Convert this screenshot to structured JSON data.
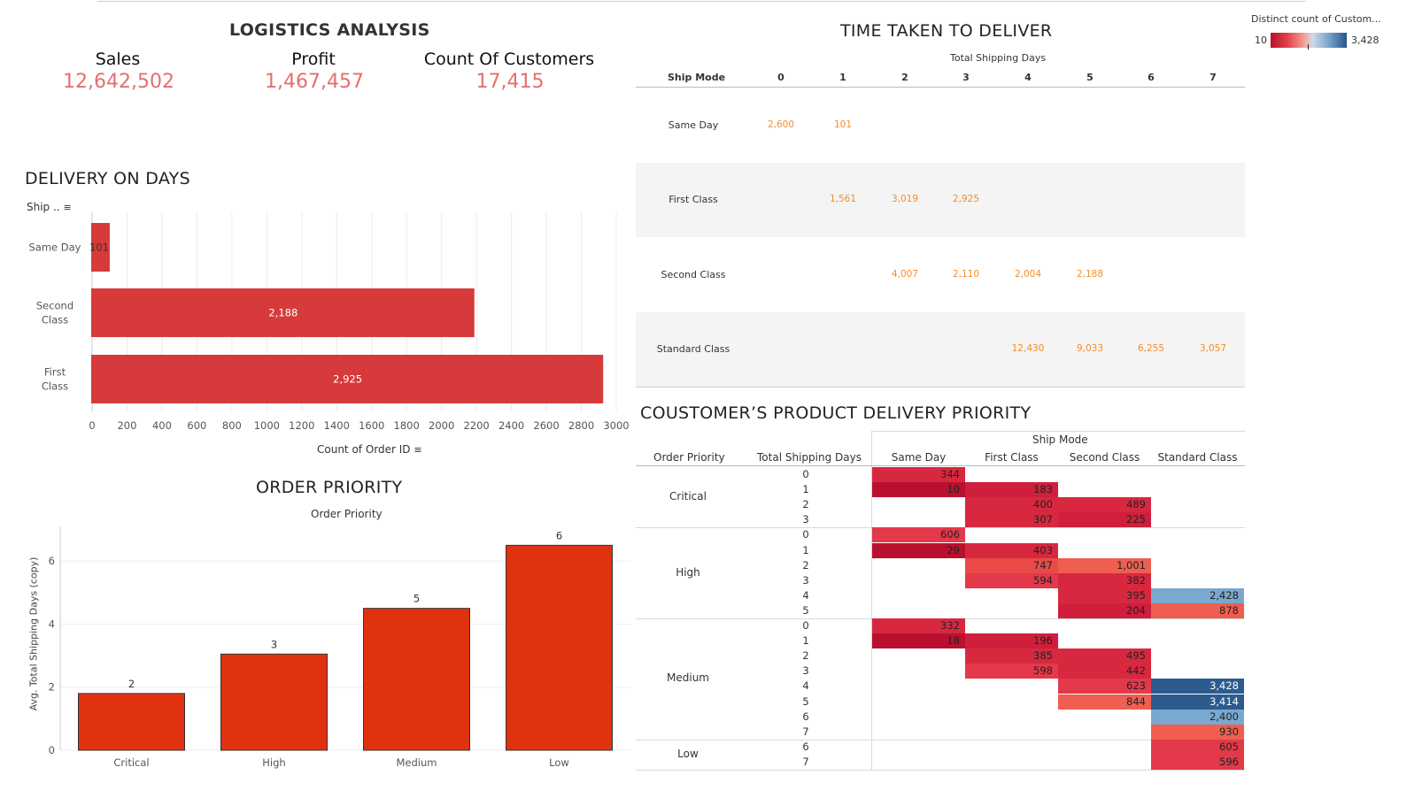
{
  "dashboard": {
    "main_title": "LOGISTICS ANALYSIS",
    "kpis": [
      {
        "label": "Sales",
        "value": "12,642,502"
      },
      {
        "label": "Profit",
        "value": "1,467,457"
      },
      {
        "label": "Count Of Customers",
        "value": "17,415"
      }
    ],
    "legend": {
      "title": "Distinct count of Custom...",
      "min": "10",
      "max": "3,428"
    }
  },
  "delivery_on_days": {
    "title": "DELIVERY ON DAYS",
    "axis_header": "Ship ..",
    "xlabel": "Count of Order ID",
    "chart_data": {
      "type": "bar",
      "orientation": "horizontal",
      "categories": [
        "Same Day",
        "Second Class",
        "First Class"
      ],
      "values": [
        101,
        2188,
        2925
      ],
      "value_labels": [
        "101",
        "2,188",
        "2,925"
      ],
      "xticks": [
        0,
        200,
        400,
        600,
        800,
        1000,
        1200,
        1400,
        1600,
        1800,
        2000,
        2200,
        2400,
        2600,
        2800,
        3000
      ],
      "xlim": [
        0,
        3000
      ],
      "color": "#d63a3a"
    }
  },
  "order_priority": {
    "title": "ORDER PRIORITY",
    "subtitle": "Order Priority",
    "ylabel": "Avg. Total Shipping Days (copy)",
    "chart_data": {
      "type": "bar",
      "categories": [
        "Critical",
        "High",
        "Medium",
        "Low"
      ],
      "values": [
        1.8,
        3.05,
        4.5,
        6.5
      ],
      "value_labels": [
        "2",
        "3",
        "5",
        "6"
      ],
      "yticks": [
        0,
        2,
        4,
        6
      ],
      "ylim": [
        0,
        7.1
      ],
      "color": "#e0320f"
    }
  },
  "time_taken": {
    "title": "TIME TAKEN TO DELIVER",
    "col_header": "Total Shipping Days",
    "row_header": "Ship Mode",
    "columns": [
      "0",
      "1",
      "2",
      "3",
      "4",
      "5",
      "6",
      "7"
    ],
    "rows": [
      {
        "label": "Same Day",
        "cells": [
          "2,600",
          "101",
          "",
          "",
          "",
          "",
          "",
          ""
        ]
      },
      {
        "label": "First Class",
        "cells": [
          "",
          "1,561",
          "3,019",
          "2,925",
          "",
          "",
          "",
          ""
        ]
      },
      {
        "label": "Second Class",
        "cells": [
          "",
          "",
          "4,007",
          "2,110",
          "2,004",
          "2,188",
          "",
          ""
        ]
      },
      {
        "label": "Standard Class",
        "cells": [
          "",
          "",
          "",
          "",
          "12,430",
          "9,033",
          "6,255",
          "3,057"
        ]
      }
    ]
  },
  "priority_heatmap": {
    "title": "COUSTOMER’S PRODUCT DELIVERY PRIORITY",
    "ship_mode_header": "Ship Mode",
    "order_priority_header": "Order Priority",
    "days_header": "Total Shipping Days",
    "columns": [
      "Same Day",
      "First Class",
      "Second Class",
      "Standard Class"
    ],
    "groups": [
      {
        "label": "Critical",
        "rows": [
          {
            "day": "0",
            "cells": [
              "344",
              "",
              "",
              ""
            ]
          },
          {
            "day": "1",
            "cells": [
              "10",
              "183",
              "",
              ""
            ]
          },
          {
            "day": "2",
            "cells": [
              "",
              "400",
              "489",
              ""
            ]
          },
          {
            "day": "3",
            "cells": [
              "",
              "307",
              "225",
              ""
            ]
          }
        ]
      },
      {
        "label": "High",
        "rows": [
          {
            "day": "0",
            "cells": [
              "606",
              "",
              "",
              ""
            ]
          },
          {
            "day": "1",
            "cells": [
              "29",
              "403",
              "",
              ""
            ]
          },
          {
            "day": "2",
            "cells": [
              "",
              "747",
              "1,001",
              ""
            ]
          },
          {
            "day": "3",
            "cells": [
              "",
              "594",
              "382",
              ""
            ]
          },
          {
            "day": "4",
            "cells": [
              "",
              "",
              "395",
              "2,428"
            ]
          },
          {
            "day": "5",
            "cells": [
              "",
              "",
              "204",
              "878"
            ]
          }
        ]
      },
      {
        "label": "Medium",
        "rows": [
          {
            "day": "0",
            "cells": [
              "332",
              "",
              "",
              ""
            ]
          },
          {
            "day": "1",
            "cells": [
              "18",
              "196",
              "",
              ""
            ]
          },
          {
            "day": "2",
            "cells": [
              "",
              "385",
              "495",
              ""
            ]
          },
          {
            "day": "3",
            "cells": [
              "",
              "598",
              "442",
              ""
            ]
          },
          {
            "day": "4",
            "cells": [
              "",
              "",
              "623",
              "3,428"
            ]
          },
          {
            "day": "5",
            "cells": [
              "",
              "",
              "844",
              "3,414"
            ]
          },
          {
            "day": "6",
            "cells": [
              "",
              "",
              "",
              "2,400"
            ]
          },
          {
            "day": "7",
            "cells": [
              "",
              "",
              "",
              "930"
            ]
          }
        ]
      },
      {
        "label": "Low",
        "rows": [
          {
            "day": "6",
            "cells": [
              "",
              "",
              "",
              "605"
            ]
          },
          {
            "day": "7",
            "cells": [
              "",
              "",
              "",
              "596"
            ]
          }
        ]
      }
    ]
  }
}
